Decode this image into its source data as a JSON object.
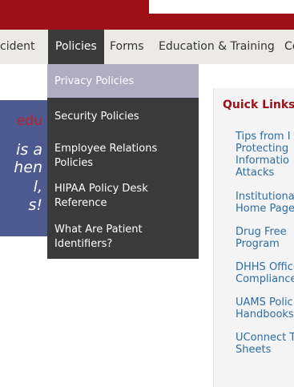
{
  "colors": {
    "brand_red": "#9e1018",
    "nav_bg": "#ebeae6",
    "dropdown_bg": "#3a3a3a",
    "dropdown_highlight": "#b0adc3",
    "link_blue": "#2d6ea3",
    "hero_blue": "#4d5a8f"
  },
  "nav": {
    "items": [
      "cident",
      "Policies",
      "Forms",
      "Education & Training",
      "Ce"
    ]
  },
  "dropdown": {
    "items": [
      {
        "lines": [
          "Privacy Policies"
        ]
      },
      {
        "lines": [
          "Security Policies"
        ]
      },
      {
        "lines": [
          "Employee Relations",
          "Policies"
        ]
      },
      {
        "lines": [
          "HIPAA Policy Desk",
          "Reference"
        ]
      },
      {
        "lines": [
          "What Are Patient",
          "Identifiers?"
        ]
      }
    ]
  },
  "hero": {
    "lines": [
      "edu",
      "is a",
      "hen",
      "l,",
      "s!"
    ]
  },
  "quick_links": {
    "title": "Quick Links",
    "links": [
      {
        "lines": [
          "Tips from I",
          "Protecting",
          "Informatio",
          "Attacks"
        ]
      },
      {
        "lines": [
          "Institutiona",
          "Home Page"
        ]
      },
      {
        "lines": [
          "Drug Free",
          "Program"
        ]
      },
      {
        "lines": [
          "DHHS Offic",
          "Compliance"
        ]
      },
      {
        "lines": [
          "UAMS Polic",
          "Handbooks"
        ]
      },
      {
        "lines": [
          "UConnect T",
          "Sheets"
        ]
      }
    ]
  }
}
